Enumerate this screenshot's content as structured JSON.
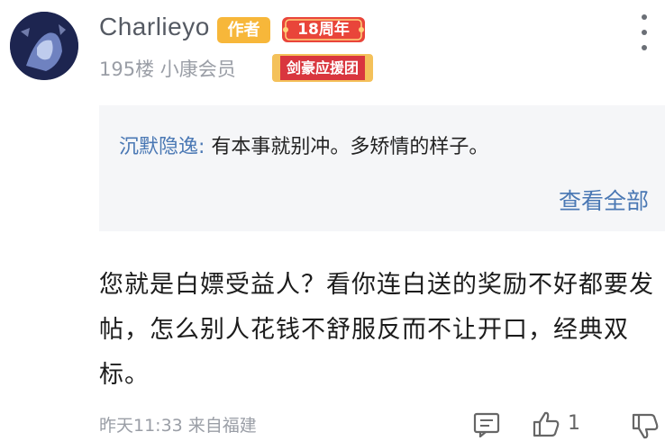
{
  "user": {
    "name": "Charlieyo",
    "author_badge": "作者",
    "anniversary_badge": "18周年",
    "floor": "195楼",
    "level": "小康会员",
    "group_badge": "剑豪应援团"
  },
  "quote": {
    "name": "沉默隐逸:",
    "text": " 有本事就别冲。多矫情的样子。",
    "view_all": "查看全部"
  },
  "content": {
    "text": "您就是白嫖受益人？看你连白送的奖励不好都要发帖，怎么别人花钱不舒服反而不让开口，经典双标。"
  },
  "footer": {
    "time": "昨天11:33 来自福建",
    "like_count": "1"
  },
  "colors": {
    "author_badge": "#f7b73a",
    "anniversary_badge": "#e9453a",
    "group_badge": "#d9363e",
    "link": "#4a78b4"
  },
  "icons": {
    "more": "more-vertical-icon",
    "comment": "comment-icon",
    "like": "thumb-up-icon",
    "dislike": "thumb-down-icon"
  }
}
